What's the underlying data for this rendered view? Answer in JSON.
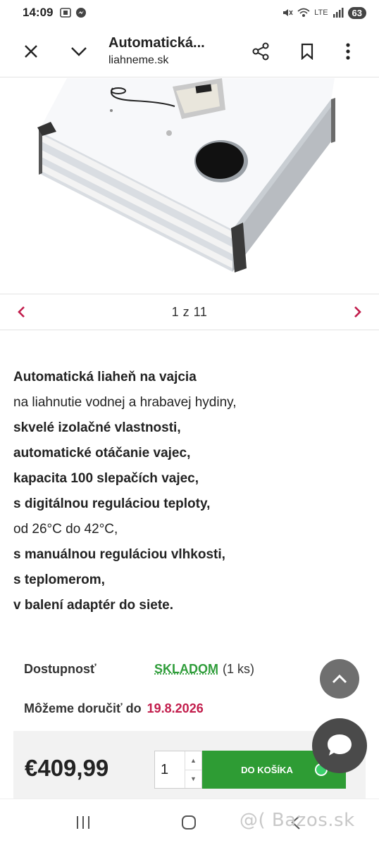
{
  "status_bar": {
    "time": "14:09",
    "battery": "63",
    "network_label": "LTE"
  },
  "header": {
    "title": "Automatická...",
    "domain": "liahneme.sk"
  },
  "gallery": {
    "counter": "1 z 11"
  },
  "description": {
    "lines": [
      "Automatická liaheň na vajcia",
      "na liahnutie vodnej a hrabavej hydiny,",
      "skvelé izolačné vlastnosti,",
      "automatické otáčanie vajec,",
      "kapacita 100 slepačích vajec,",
      "s digitálnou reguláciou teploty,",
      "od 26°C do 42°C,",
      "s manuálnou reguláciou vlhkosti,",
      "s teplomerom,",
      "v balení adaptér do siete."
    ]
  },
  "availability": {
    "label": "Dostupnosť",
    "status": "SKLADOM",
    "quantity": "(1 ks)"
  },
  "delivery": {
    "label": "Môžeme doručiť do",
    "date": "19.8.2026"
  },
  "purchase": {
    "price": "€409,99",
    "quantity": "1",
    "cart_button": "DO KOŠÍKA"
  },
  "watermark": "@( Bazos.sk",
  "colors": {
    "accent_green": "#2e9c34",
    "date_red": "#c21d4c",
    "arrow_red": "#c21d4c"
  }
}
